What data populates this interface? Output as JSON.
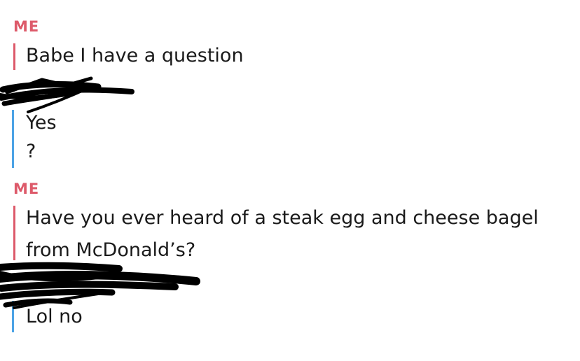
{
  "conversation": [
    {
      "sender_label": "ME",
      "lines": [
        "Babe I have a question"
      ]
    },
    {
      "sender_label": "",
      "lines": [
        "Yes",
        "?"
      ]
    },
    {
      "sender_label": "ME",
      "lines": [
        "Have you ever heard of a steak egg and cheese bagel",
        "from McDonald’s?"
      ]
    },
    {
      "sender_label": "",
      "lines": [
        "Lol no"
      ]
    }
  ],
  "colors": {
    "me_accent": "#dd5a6a",
    "them_accent": "#4ca3e6",
    "redaction": "#000000"
  },
  "redactions": [
    "name-redaction-scribble",
    "name-redaction-scribble"
  ]
}
